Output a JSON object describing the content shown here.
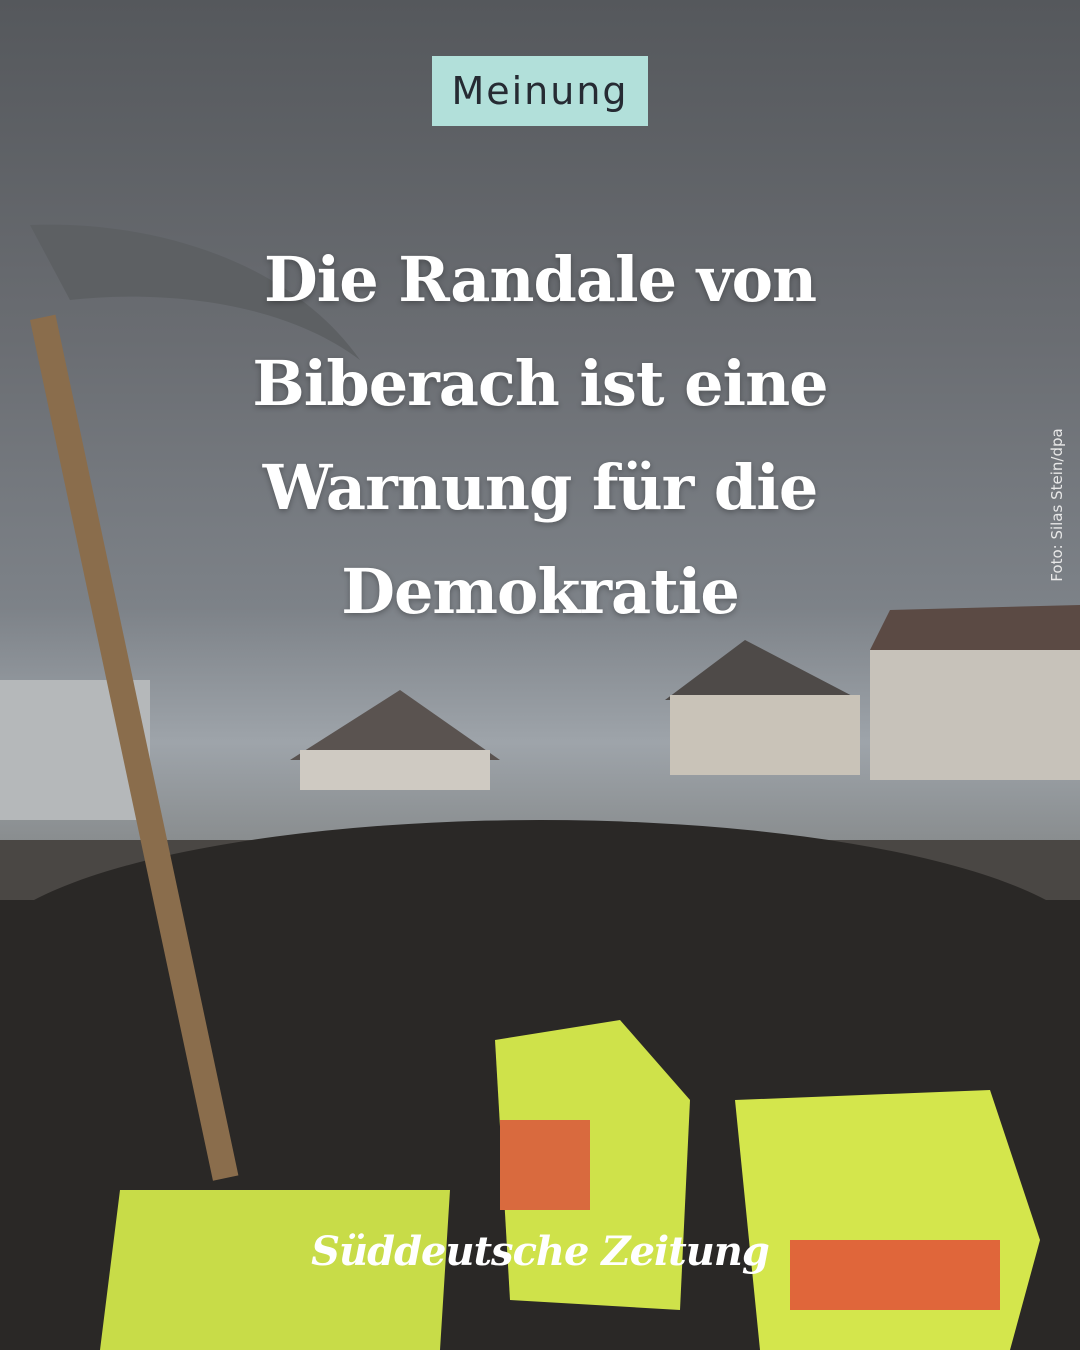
{
  "badge": {
    "label": "Meinung",
    "background": "#b2e0da"
  },
  "headline": {
    "lines": [
      "Die Randale von",
      "Biberach ist eine",
      "Warnung für die",
      "Demokratie"
    ]
  },
  "photo": {
    "credit": "Foto: Silas Stein/dpa"
  },
  "brand": {
    "logo_text": "Süddeutsche Zeitung"
  }
}
